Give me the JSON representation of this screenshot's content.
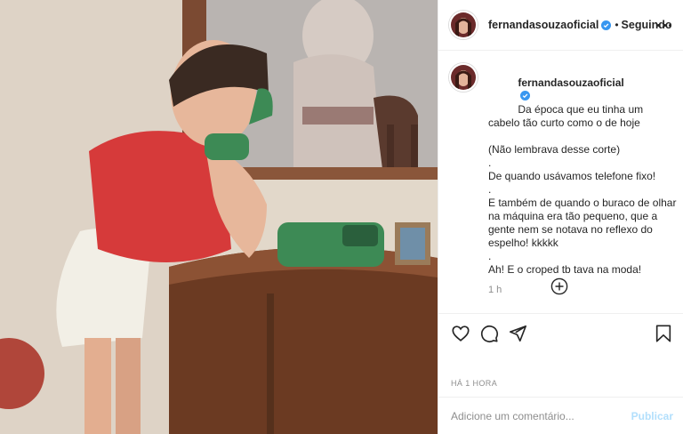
{
  "header": {
    "username": "fernandasouzaoficial",
    "separator": "•",
    "follow_status": "Seguindo"
  },
  "caption": {
    "username": "fernandasouzaoficial",
    "lines": [
      "Da época que eu tinha um cabelo tão curto como o de hoje",
      "(Não lembrava desse corte)",
      ".",
      "De quando usávamos telefone fixo!",
      ".",
      "E também de quando o buraco de olhar na máquina era tão pequeno, que a gente nem se notava no reflexo do espelho! kkkkk",
      ".",
      "Ah! E o croped tb tava na moda!"
    ],
    "time": "1 h"
  },
  "icons": {
    "more": "more-dots-icon",
    "verified": "verified-badge-icon",
    "load_more": "plus-circle-icon",
    "like": "heart-icon",
    "comment": "comment-icon",
    "share": "share-icon",
    "save": "bookmark-icon"
  },
  "post_date": "HÁ 1 HORA",
  "comment_box": {
    "placeholder": "Adicione um comentário...",
    "publish_label": "Publicar"
  },
  "colors": {
    "verified": "#3897f0",
    "publish_disabled": "#b2dffc",
    "secondary_text": "#8e8e8e",
    "divider": "#efefef"
  }
}
